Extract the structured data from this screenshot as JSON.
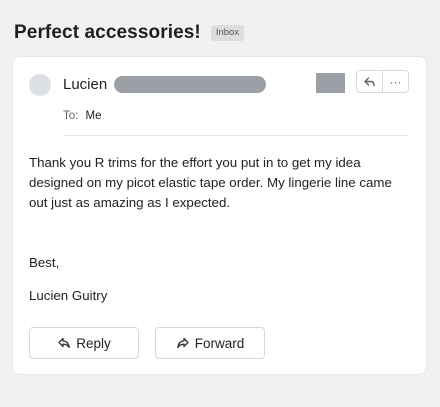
{
  "email": {
    "subject": "Perfect accessories!",
    "folder_badge": "Inbox",
    "sender_name": "Lucien",
    "to_label": "To:",
    "to_value": "Me",
    "body": "Thank you R trims for the effort you put in to get my idea designed on my picot elastic tape order. My lingerie line came out just as amazing as I expected.",
    "closing": "Best,",
    "signature": "Lucien Guitry"
  },
  "actions": {
    "reply_label": "Reply",
    "forward_label": "Forward",
    "more_glyph": "···"
  },
  "icons": {
    "reply_icon": "reply-arrow-icon",
    "forward_icon": "forward-arrow-icon",
    "more_icon": "more-horizontal-icon"
  },
  "colors": {
    "background": "#f1f1f1",
    "card": "#ffffff",
    "redaction": "#9aa0a6",
    "avatar": "#dcdfe3"
  }
}
